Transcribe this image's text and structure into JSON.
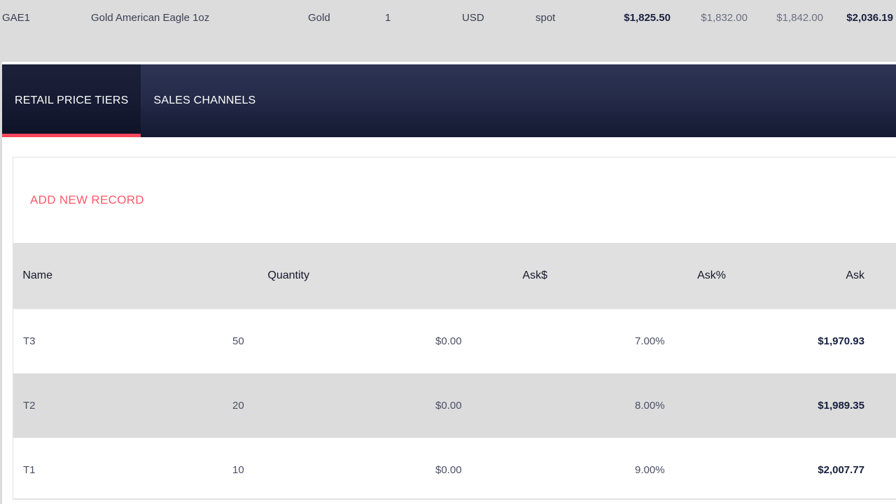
{
  "product_summary": {
    "sku": "GAE1",
    "description": "Gold American Eagle 1oz",
    "metal": "Gold",
    "quantity": "1",
    "currency": "USD",
    "price_type": "spot",
    "spot_price": "$1,825.50",
    "bid_price": "$1,832.00",
    "mid_price": "$1,842.00",
    "ask_price": "$2,036.19"
  },
  "tabs": [
    {
      "label": "RETAIL PRICE TIERS",
      "active": true
    },
    {
      "label": "SALES CHANNELS",
      "active": false
    }
  ],
  "toolbar": {
    "add_record_label": "ADD NEW RECORD"
  },
  "table": {
    "columns": [
      "Name",
      "Quantity",
      "Ask$",
      "Ask%",
      "Ask"
    ],
    "rows": [
      {
        "name": "T3",
        "quantity": "50",
        "ask_dollar": "$0.00",
        "ask_percent": "7.00%",
        "ask": "$1,970.93"
      },
      {
        "name": "T2",
        "quantity": "20",
        "ask_dollar": "$0.00",
        "ask_percent": "8.00%",
        "ask": "$1,989.35"
      },
      {
        "name": "T1",
        "quantity": "10",
        "ask_dollar": "$0.00",
        "ask_percent": "9.00%",
        "ask": "$2,007.77"
      }
    ]
  },
  "colors": {
    "accent_red": "#f8475b",
    "tab_navy": "#252b49",
    "tab_active_navy": "#151a31",
    "band_gray": "#dcdcdc",
    "value_dark": "#16203f"
  }
}
